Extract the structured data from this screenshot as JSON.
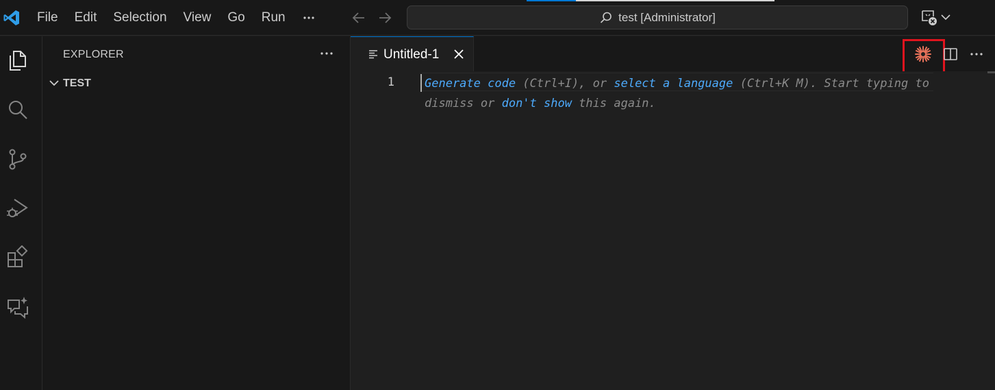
{
  "menu": {
    "items": [
      "File",
      "Edit",
      "Selection",
      "View",
      "Go",
      "Run"
    ],
    "more_icon": "ellipsis-icon"
  },
  "command_center": {
    "label": "test [Administrator]",
    "icon": "search-icon"
  },
  "activity_bar": {
    "icons": [
      "explorer-icon",
      "search-icon",
      "source-control-icon",
      "run-debug-icon",
      "extensions-icon",
      "chat-icon"
    ]
  },
  "sidebar": {
    "title": "EXPLORER",
    "folder": "TEST"
  },
  "editor": {
    "tab_label": "Untitled-1",
    "line_number": "1",
    "hint": {
      "link1": "Generate code",
      "text1": " (Ctrl+I), or ",
      "link2": "select a language",
      "text2": " (Ctrl+K M). Start typing to dismiss or ",
      "link3": "don't show",
      "text3": " this again."
    }
  },
  "colors": {
    "accent": "#0078d4",
    "highlight_box": "#e0141e",
    "link": "#4daafc",
    "copilot_icon": "#e8725a"
  }
}
